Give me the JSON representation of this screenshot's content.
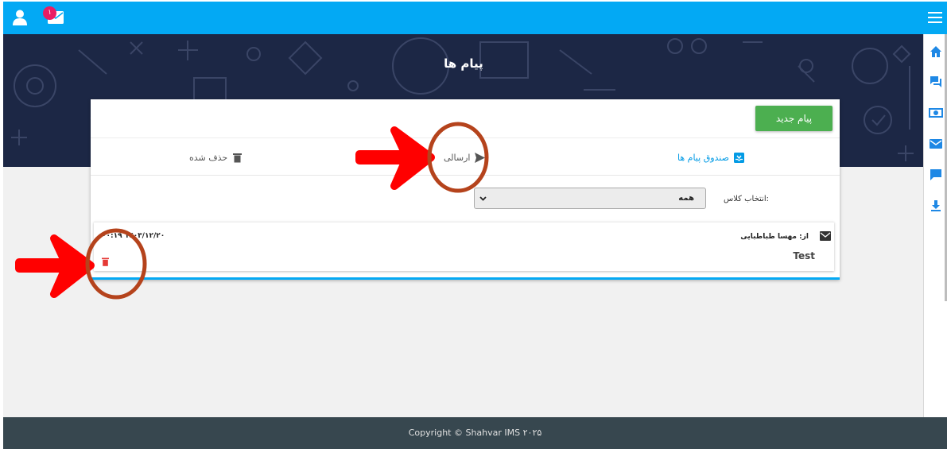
{
  "topbar": {
    "notification_count": "۱",
    "icons": [
      "user-icon",
      "mail-icon",
      "menu-icon"
    ]
  },
  "sidenav": {
    "items": [
      "home-icon",
      "forum-icon",
      "money-icon",
      "mail-icon",
      "chat-icon",
      "download-icon"
    ]
  },
  "banner": {
    "title": "پیام ها"
  },
  "card": {
    "new_message_label": "پیام جدید",
    "tabs": [
      {
        "label": "صندوق پیام ها",
        "icon": "inbox-icon",
        "active": true
      },
      {
        "label": "ارسالی",
        "icon": "send-icon",
        "active": false
      },
      {
        "label": "حذف شده",
        "icon": "trash-icon",
        "active": false
      }
    ],
    "filter": {
      "label": "انتخاب کلاس:",
      "selected": "همه"
    },
    "messages": [
      {
        "from": "از: مهسا طباطبایی",
        "date": "۰۰:۱۹ ۱۴۰۳/۱۲/۲۰",
        "body": "Test"
      }
    ]
  },
  "footer": {
    "copyright": "Copyright © Shahvar IMS ۲۰۲۵"
  },
  "colors": {
    "topbar": "#03a9f4",
    "banner": "#1c2745",
    "primary_button": "#4caf50",
    "active_tab": "#039be5",
    "badge": "#e91e63",
    "delete_icon": "#e53935",
    "annotation_arrow": "#ff0000",
    "annotation_circle": "#b5431c",
    "footer": "#37474f"
  }
}
